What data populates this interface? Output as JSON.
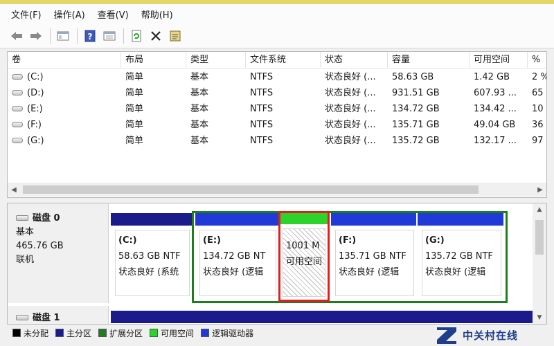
{
  "colors": {
    "unallocated": "#000000",
    "primary": "#1b1b8c",
    "extended": "#1e7e1e",
    "free": "#2bd32b",
    "logical": "#1f3ad6",
    "selection": "#e01e1e"
  },
  "menu": [
    {
      "label": "文件(F)"
    },
    {
      "label": "操作(A)"
    },
    {
      "label": "查看(V)"
    },
    {
      "label": "帮助(H)"
    }
  ],
  "toolbar": {
    "icons": [
      "back-arrow-icon",
      "forward-arrow-icon",
      "console-tree-icon",
      "help-icon",
      "properties-icon",
      "refresh-icon",
      "delete-icon",
      "checklist-icon"
    ]
  },
  "volume_list": {
    "columns": [
      "卷",
      "布局",
      "类型",
      "文件系统",
      "状态",
      "容量",
      "可用空间",
      "%"
    ],
    "rows": [
      {
        "volume": "(C:)",
        "layout": "简单",
        "type": "基本",
        "fs": "NTFS",
        "status": "状态良好 (...",
        "capacity": "58.63 GB",
        "free": "1.42 GB",
        "pct": "2 %"
      },
      {
        "volume": "(D:)",
        "layout": "简单",
        "type": "基本",
        "fs": "NTFS",
        "status": "状态良好 (...",
        "capacity": "931.51 GB",
        "free": "607.93 ...",
        "pct": "65"
      },
      {
        "volume": "(E:)",
        "layout": "简单",
        "type": "基本",
        "fs": "NTFS",
        "status": "状态良好 (...",
        "capacity": "134.72 GB",
        "free": "134.42 ...",
        "pct": "10"
      },
      {
        "volume": "(F:)",
        "layout": "简单",
        "type": "基本",
        "fs": "NTFS",
        "status": "状态良好 (...",
        "capacity": "135.71 GB",
        "free": "49.04 GB",
        "pct": "36"
      },
      {
        "volume": "(G:)",
        "layout": "简单",
        "type": "基本",
        "fs": "NTFS",
        "status": "状态良好 (...",
        "capacity": "135.72 GB",
        "free": "132.17 ...",
        "pct": "97"
      }
    ]
  },
  "disks": [
    {
      "name": "磁盘 0",
      "type": "基本",
      "size": "465.76 GB",
      "state": "联机",
      "partitions": [
        {
          "label": "(C:)",
          "line1": "58.63 GB NTF",
          "line2": "状态良好 (系统"
        },
        {
          "label": "(E:)",
          "line1": "134.72 GB NT",
          "line2": "状态良好 (逻辑"
        },
        {
          "label": "",
          "line1": "1001 M",
          "line2": "可用空间"
        },
        {
          "label": "(F:)",
          "line1": "135.71 GB NTF",
          "line2": "状态良好 (逻辑"
        },
        {
          "label": "(G:)",
          "line1": "135.72 GB NTF",
          "line2": "状态良好 (逻辑"
        }
      ]
    },
    {
      "name": "磁盘 1"
    }
  ],
  "legend": [
    {
      "label": "未分配",
      "color": "#000000"
    },
    {
      "label": "主分区",
      "color": "#1b1b8c"
    },
    {
      "label": "扩展分区",
      "color": "#1e7e1e"
    },
    {
      "label": "可用空间",
      "color": "#2bd32b"
    },
    {
      "label": "逻辑驱动器",
      "color": "#1f3ad6"
    }
  ],
  "watermark": {
    "text": "中关村在线"
  }
}
